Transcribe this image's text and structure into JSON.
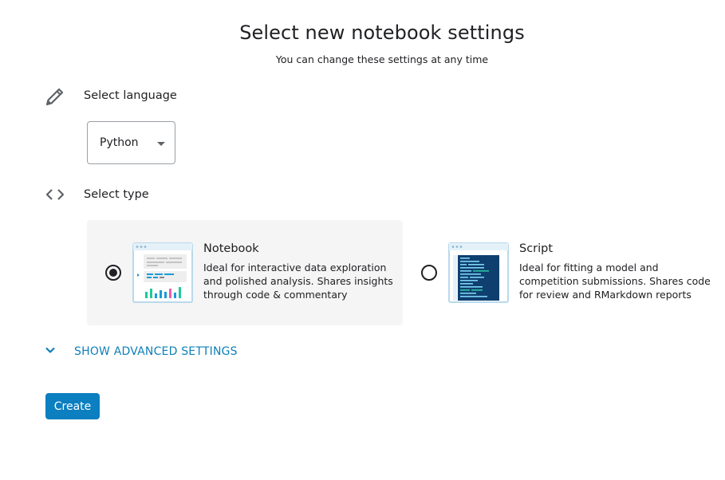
{
  "header": {
    "title": "Select new notebook settings",
    "subtitle": "You can change these settings at any time"
  },
  "language_section": {
    "icon": "pencil-icon",
    "label": "Select language",
    "selected_value": "Python"
  },
  "type_section": {
    "icon": "code-brackets-icon",
    "label": "Select type",
    "options": [
      {
        "title": "Notebook",
        "description": "Ideal for interactive data exploration and polished analysis. Shares insights through code & commentary",
        "selected": true,
        "thumbnail": "notebook-thumbnail"
      },
      {
        "title": "Script",
        "description": "Ideal for fitting a model and competition submissions. Shares code for review and RMarkdown reports",
        "selected": false,
        "thumbnail": "script-thumbnail"
      }
    ]
  },
  "advanced": {
    "icon": "chevron-down-icon",
    "label": "SHOW ADVANCED SETTINGS"
  },
  "actions": {
    "create_label": "Create"
  },
  "colors": {
    "accent": "#0f7fb8",
    "button": "#0b7fc0",
    "selected_card_bg": "#f5f5f5"
  }
}
